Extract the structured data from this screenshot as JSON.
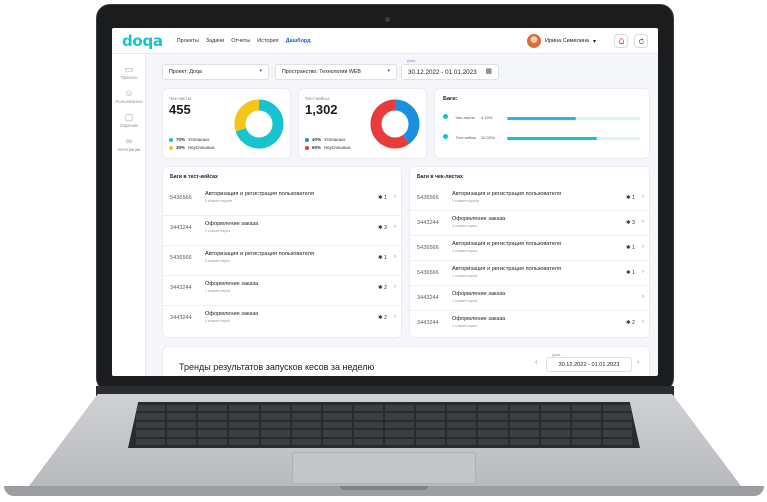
{
  "app": {
    "logo": "doqa",
    "nav": [
      "Проекты",
      "Задачи",
      "Отчеты",
      "История",
      "Дашборд"
    ],
    "active_nav": "Дашборд",
    "user_name": "Ирина Симилина",
    "bell_icon": "bell-icon",
    "refresh_icon": "refresh-icon"
  },
  "sidebar": {
    "items": [
      {
        "label": "Проекты",
        "icon": "folder-icon"
      },
      {
        "label": "Пользователи",
        "icon": "users-icon"
      },
      {
        "label": "Задачник",
        "icon": "document-icon"
      },
      {
        "label": "Интеграции",
        "icon": "link-icon"
      }
    ]
  },
  "filters": {
    "project": "Проект: Доqа",
    "space": "Пространство: Технологии WEB",
    "date_label": "Дата",
    "date_range": "30.12.2022 - 01.01.2023",
    "calendar_icon": "calendar-icon"
  },
  "checklists": {
    "label": "Чек-листы:",
    "total": "455",
    "success_pct": "70%",
    "success_label": "Успешных",
    "fail_pct": "30%",
    "fail_label": "Неуспешных",
    "success_fraction": 0.7,
    "color_success": "#17c3cf",
    "color_fail": "#f5c518"
  },
  "testcases": {
    "label": "Тест-кейсы:",
    "total": "1,302",
    "success_pct": "40%",
    "success_label": "Успешных",
    "fail_pct": "60%",
    "fail_label": "Неуспешных",
    "success_fraction": 0.4,
    "color_success": "#1a8fe0",
    "color_fail": "#e83b3b"
  },
  "bugs": {
    "title": "Баги:",
    "rows": [
      {
        "label": "Чек-листы",
        "pct": "4.13%",
        "fraction": 0.52
      },
      {
        "label": "Тест-кейсы",
        "pct": "10.33%",
        "fraction": 0.68
      }
    ]
  },
  "bugs_testcases": {
    "title": "Баги в тест-кейсах",
    "rows": [
      {
        "id": "5436566",
        "name": "Авторизация и регистрация пользователя",
        "sub": "5 комментариев",
        "bugs": "1"
      },
      {
        "id": "3443244",
        "name": "Оформление заказа",
        "sub": "2 комментария",
        "bugs": "3"
      },
      {
        "id": "5436566",
        "name": "Авторизация и регистрация пользователя",
        "sub": "3 комментария",
        "bugs": "1"
      },
      {
        "id": "3443244",
        "name": "Оформление заказа",
        "sub": "1 комментарий",
        "bugs": "2"
      },
      {
        "id": "3443244",
        "name": "Оформление заказа",
        "sub": "4 комментария",
        "bugs": "2"
      }
    ]
  },
  "bugs_checklists": {
    "title": "Баги в чек-листах",
    "rows": [
      {
        "id": "5436566",
        "name": "Авторизация и регистрация пользователя",
        "sub": "5 комментариев",
        "bugs": "1"
      },
      {
        "id": "3443244",
        "name": "Оформление заказа",
        "sub": "2 комментария",
        "bugs": "3"
      },
      {
        "id": "5436566",
        "name": "Авторизация и регистрация пользователя",
        "sub": "3 комментария",
        "bugs": "1"
      },
      {
        "id": "5436566",
        "name": "Авторизация и регистрация пользователя",
        "sub": "1 комментарий",
        "bugs": "1"
      },
      {
        "id": "3443244",
        "name": "Оформление заказа",
        "sub": "1 комментарий",
        "bugs": ""
      },
      {
        "id": "3443244",
        "name": "Оформление заказа",
        "sub": "4 комментария",
        "bugs": "2"
      }
    ]
  },
  "trends": {
    "title": "Тренды результатов запусков кесов за неделю",
    "date_label": "Дата",
    "date_range": "30.12.2022 - 01.01.2023",
    "prev": "‹",
    "next": "›"
  }
}
